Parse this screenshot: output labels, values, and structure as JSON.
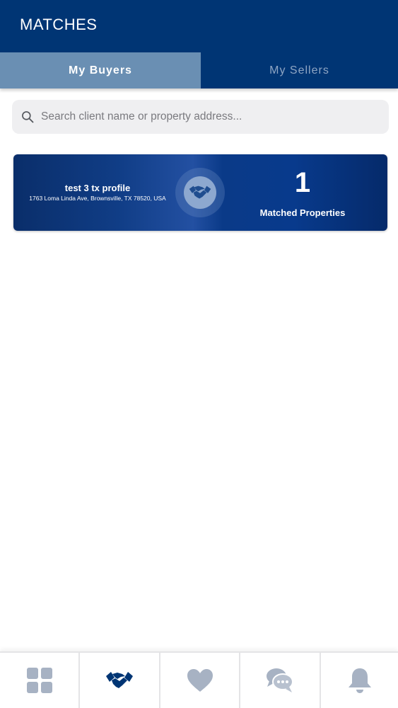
{
  "header": {
    "title": "MATCHES"
  },
  "tabs": [
    {
      "label": "My Buyers",
      "active": true
    },
    {
      "label": "My Sellers",
      "active": false
    }
  ],
  "search": {
    "placeholder": "Search client name or property address...",
    "value": "",
    "icon": "search-icon"
  },
  "matches": [
    {
      "client_name": "test 3 tx profile",
      "address": "1763 Loma Linda Ave, Brownsville, TX 78520, USA",
      "icon": "handshake-icon",
      "count": "1",
      "count_label": "Matched Properties"
    }
  ],
  "bottom_nav": [
    {
      "icon": "dashboard-grid-icon",
      "active": false
    },
    {
      "icon": "handshake-icon",
      "active": true
    },
    {
      "icon": "heart-icon",
      "active": false
    },
    {
      "icon": "chat-bubbles-icon",
      "active": false
    },
    {
      "icon": "bell-icon",
      "active": false
    }
  ],
  "colors": {
    "brand_navy": "#003574",
    "active_tab": "#6a8fb3",
    "nav_inactive": "#a7b2c3",
    "nav_active": "#003574"
  }
}
